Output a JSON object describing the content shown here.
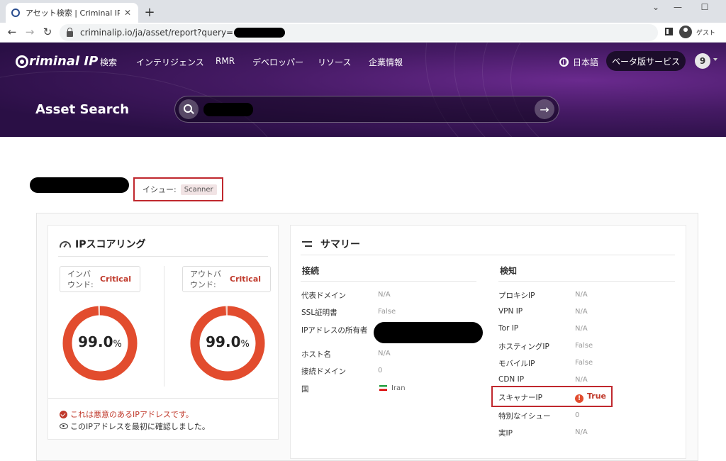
{
  "browser": {
    "tab_title": "アセット検索 | Criminal IP(クリミ",
    "url": "criminalip.io/ja/asset/report?query=",
    "profile_label": "ゲスト"
  },
  "header": {
    "logo": "riminal IP",
    "nav": [
      "検索",
      "インテリジェンス",
      "RMR",
      "デベロッパー",
      "リソース",
      "企業情報"
    ],
    "language": "日本語",
    "beta_button": "ベータ版サービス",
    "user_badge": "9",
    "page_title": "Asset Search"
  },
  "issue": {
    "label": "イシュー:",
    "tag": "Scanner"
  },
  "score": {
    "title": "IPスコアリング",
    "inbound": {
      "label_line1": "インバ",
      "label_line2": "ウンド:",
      "level": "Critical",
      "score": 99.0,
      "score_text": "99.0",
      "unit": "%"
    },
    "outbound": {
      "label_line1": "アウトバ",
      "label_line2": "ウンド:",
      "level": "Critical",
      "score": 99.0,
      "score_text": "99.0",
      "unit": "%"
    },
    "note_malicious": "これは悪意のあるIPアドレスです。",
    "note_first_seen": "このIPアドレスを最初に確認しました。"
  },
  "summary": {
    "title": "サマリー",
    "connection": {
      "heading": "接続",
      "rows": [
        {
          "label": "代表ドメイン",
          "value": "N/A"
        },
        {
          "label": "SSL証明書",
          "value": "False"
        },
        {
          "label": "IPアドレスの所有者",
          "value": ""
        },
        {
          "label": "ホスト名",
          "value": "N/A"
        },
        {
          "label": "接続ドメイン",
          "value": "0"
        },
        {
          "label": "国",
          "value": "Iran"
        }
      ]
    },
    "detection": {
      "heading": "検知",
      "rows": [
        {
          "label": "プロキシIP",
          "value": "N/A"
        },
        {
          "label": "VPN IP",
          "value": "N/A"
        },
        {
          "label": "Tor IP",
          "value": "N/A"
        },
        {
          "label": "ホスティングIP",
          "value": "False"
        },
        {
          "label": "モバイルIP",
          "value": "False"
        },
        {
          "label": "CDN IP",
          "value": "N/A"
        },
        {
          "label": "スキャナーIP",
          "value": "True"
        },
        {
          "label": "特別なイシュー",
          "value": "0"
        },
        {
          "label": "実IP",
          "value": "N/A"
        }
      ]
    }
  },
  "colors": {
    "critical": "#e24c2e",
    "header_bg": "#451a64",
    "highlight_box": "#c0282e"
  }
}
